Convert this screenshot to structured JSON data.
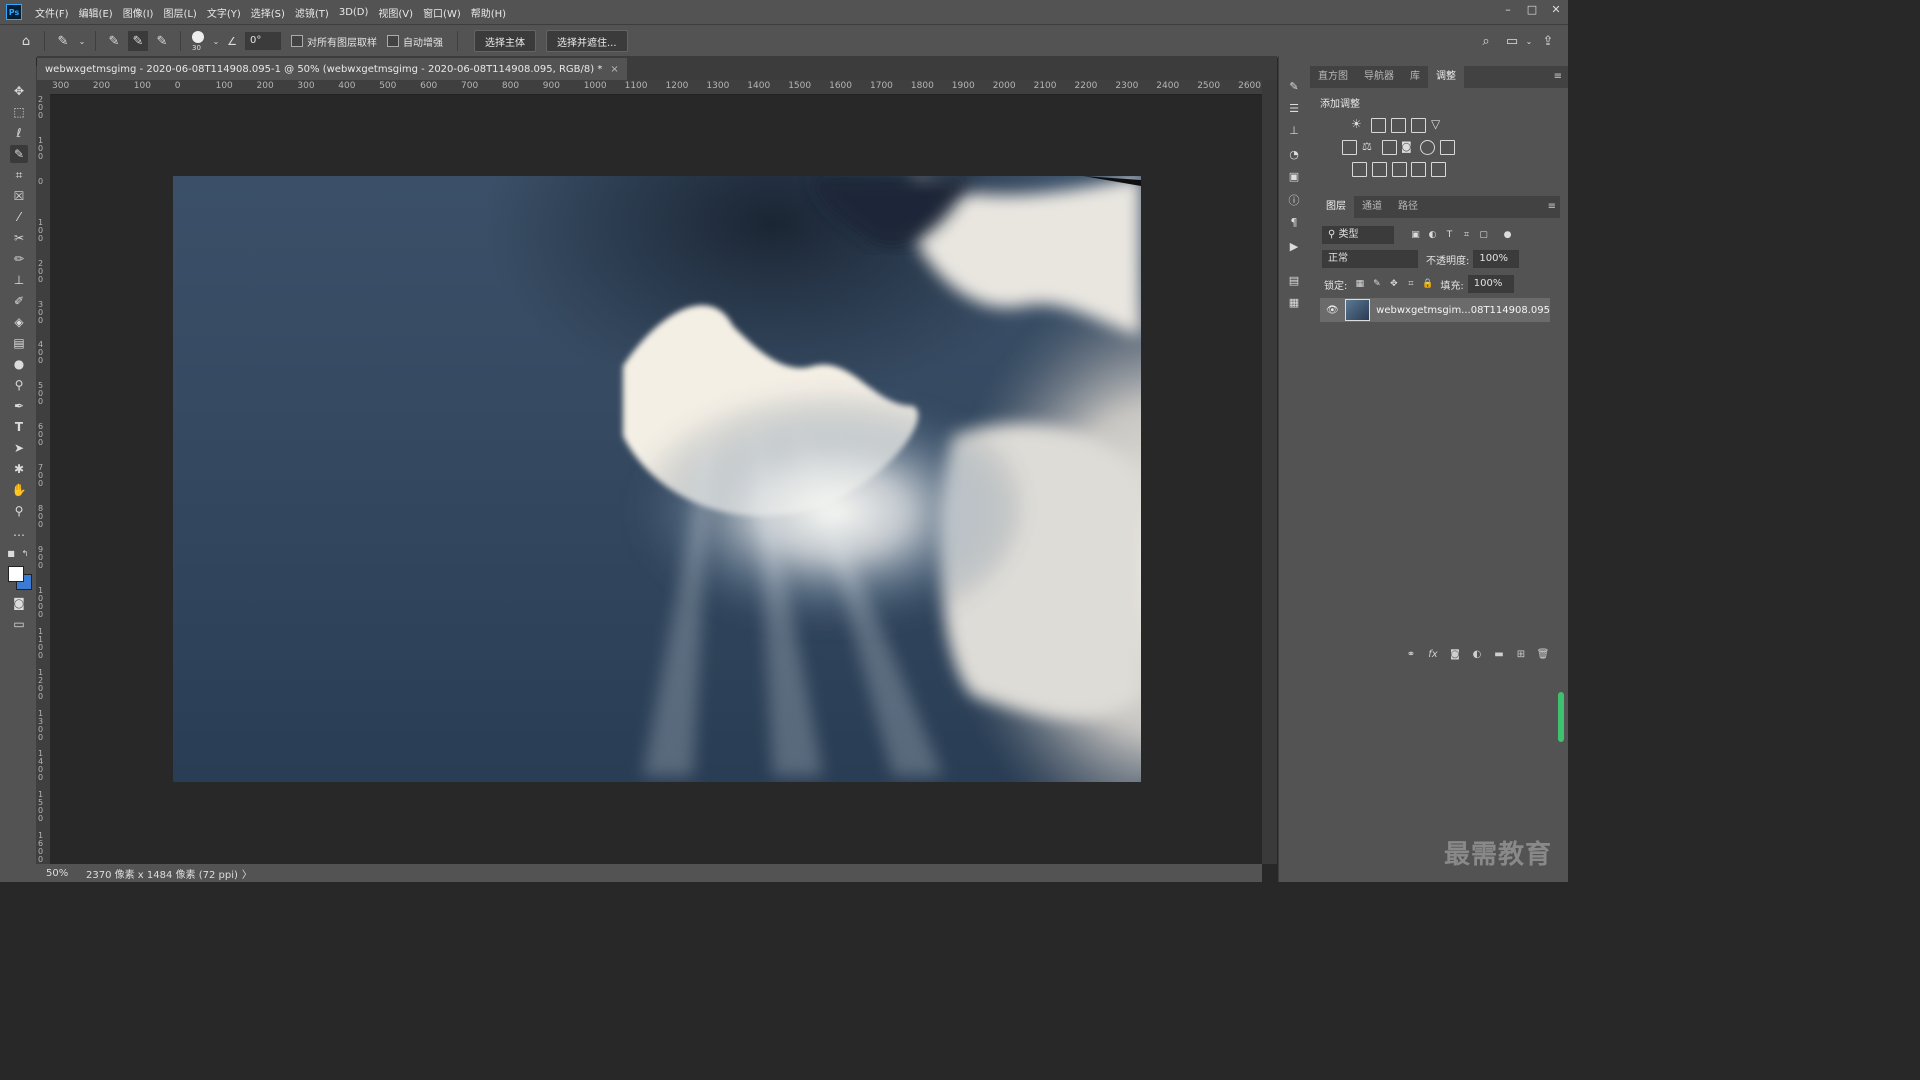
{
  "app": {
    "logo": "Ps",
    "menu": [
      "文件(F)",
      "编辑(E)",
      "图像(I)",
      "图层(L)",
      "文字(Y)",
      "选择(S)",
      "滤镜(T)",
      "3D(D)",
      "视图(V)",
      "窗口(W)",
      "帮助(H)"
    ],
    "window_controls": [
      "–",
      "□",
      "✕"
    ]
  },
  "options": {
    "brush_size": "30",
    "angle_value": "0°",
    "sample_all_layers_label": "对所有图层取样",
    "auto_enhance_label": "自动增强",
    "select_subject_button": "选择主体",
    "select_and_mask_button": "选择并遮住..."
  },
  "document": {
    "tab_title": "webwxgetmsgimg - 2020-06-08T114908.095-1 @ 50% (webwxgetmsgimg - 2020-06-08T114908.095, RGB/8) *",
    "tab_close": "×",
    "ruler_h_labels": [
      "300",
      "200",
      "100",
      "0",
      "100",
      "200",
      "300",
      "400",
      "500",
      "600",
      "700",
      "800",
      "900",
      "1000",
      "1100",
      "1200",
      "1300",
      "1400",
      "1500",
      "1600",
      "1700",
      "1800",
      "1900",
      "2000",
      "2100",
      "2200",
      "2300",
      "2400",
      "2500",
      "2600"
    ],
    "ruler_v_labels": [
      "200",
      "100",
      "0",
      "100",
      "200",
      "300",
      "400",
      "500",
      "600",
      "700",
      "800",
      "900",
      "1000",
      "1100",
      "1200",
      "1300",
      "1400",
      "1500",
      "1600"
    ]
  },
  "status": {
    "zoom": "50%",
    "doc_info": "2370 像素 x 1484 像素 (72 ppi)",
    "arrow": "〉"
  },
  "panels": {
    "adjust_tabs": [
      "直方图",
      "导航器",
      "库",
      "调整"
    ],
    "active_adjust_tab": "调整",
    "add_adjustment_title": "添加调整",
    "layers_tabs": [
      "图层",
      "通道",
      "路径"
    ],
    "filter_kind": "类型",
    "blend_mode": "正常",
    "opacity_label": "不透明度:",
    "opacity_value": "100%",
    "lock_label": "锁定:",
    "fill_label": "填充:",
    "fill_value": "100%",
    "layer_name": "webwxgetmsgim...08T114908.095",
    "footer_fx": "fx"
  },
  "watermark": "最需教育",
  "colors": {
    "foreground": "#ffffff",
    "background": "#3c7bd4",
    "ui_gray": "#535353",
    "canvas_bg": "#282828"
  }
}
